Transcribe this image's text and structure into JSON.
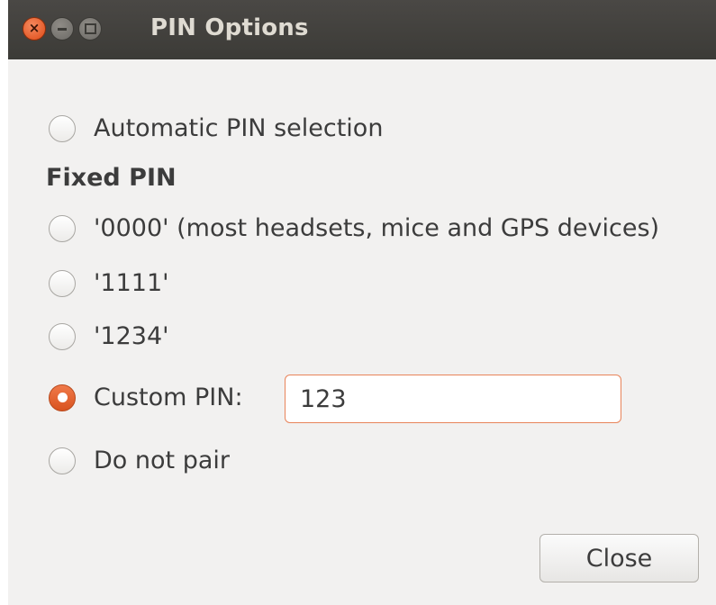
{
  "window": {
    "title": "PIN Options",
    "close_symbol": "×",
    "icons": [
      "close-icon",
      "minimize-icon",
      "maximize-icon"
    ]
  },
  "options": {
    "automatic_label": "Automatic PIN selection",
    "fixed_section_label": "Fixed PIN",
    "pin_0000_label": "'0000' (most headsets, mice and GPS devices)",
    "pin_1111_label": "'1111'",
    "pin_1234_label": "'1234'",
    "custom_label": "Custom PIN:",
    "custom_value": "123",
    "do_not_pair_label": "Do not pair",
    "selected": "custom"
  },
  "footer": {
    "close_label": "Close"
  },
  "colors": {
    "accent": "#dd4814",
    "titlebar": "#3c3b37",
    "background": "#f2f1f0"
  }
}
